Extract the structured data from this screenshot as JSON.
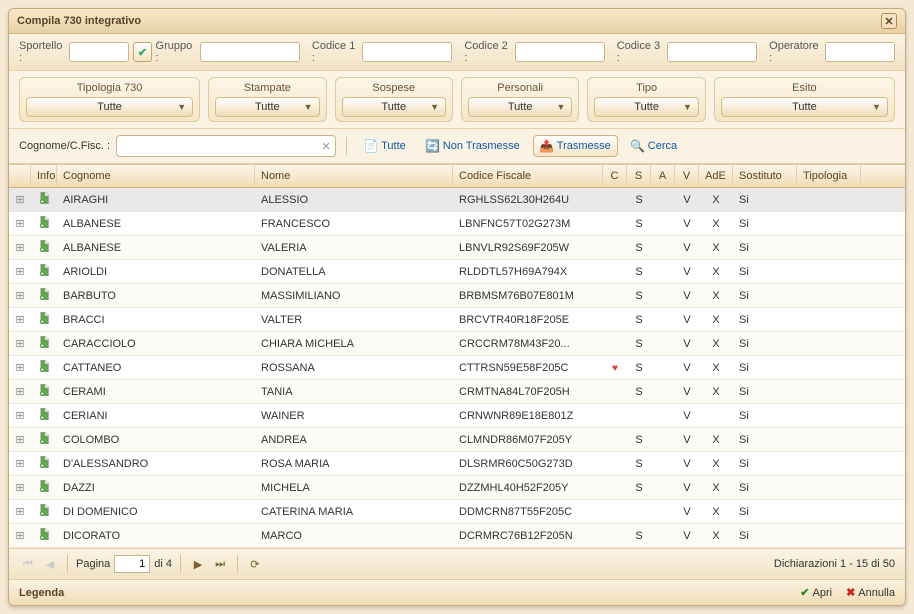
{
  "window": {
    "title": "Compila 730 integrativo"
  },
  "filters1": {
    "sportello": "Sportello :",
    "gruppo": "Gruppo :",
    "codice1": "Codice 1 :",
    "codice2": "Codice 2 :",
    "codice3": "Codice 3 :",
    "operatore": "Operatore :"
  },
  "dropdowns": [
    {
      "label": "Tipologia 730",
      "value": "Tutte"
    },
    {
      "label": "Stampate",
      "value": "Tutte"
    },
    {
      "label": "Sospese",
      "value": "Tutte"
    },
    {
      "label": "Personali",
      "value": "Tutte"
    },
    {
      "label": "Tipo",
      "value": "Tutte"
    },
    {
      "label": "Esito",
      "value": "Tutte"
    }
  ],
  "search": {
    "label": "Cognome/C.Fisc. :",
    "tutte": "Tutte",
    "non_trasmesse": "Non Trasmesse",
    "trasmesse": "Trasmesse",
    "cerca": "Cerca"
  },
  "columns": {
    "info": "Info",
    "cognome": "Cognome",
    "nome": "Nome",
    "cf": "Codice Fiscale",
    "c": "C",
    "s": "S",
    "a": "A",
    "v": "V",
    "ade": "AdE",
    "sostituto": "Sostituto",
    "tipologia": "Tipologia"
  },
  "rows": [
    {
      "cognome": "AIRAGHI",
      "nome": "ALESSIO",
      "cf": "RGHLSS62L30H264U",
      "c": "",
      "s": "S",
      "a": "",
      "v": "V",
      "ade": "X",
      "sost": "Si",
      "sel": true
    },
    {
      "cognome": "ALBANESE",
      "nome": "FRANCESCO",
      "cf": "LBNFNC57T02G273M",
      "c": "",
      "s": "S",
      "a": "",
      "v": "V",
      "ade": "X",
      "sost": "Si"
    },
    {
      "cognome": "ALBANESE",
      "nome": "VALERIA",
      "cf": "LBNVLR92S69F205W",
      "c": "",
      "s": "S",
      "a": "",
      "v": "V",
      "ade": "X",
      "sost": "Si"
    },
    {
      "cognome": "ARIOLDI",
      "nome": "DONATELLA",
      "cf": "RLDDTL57H69A794X",
      "c": "",
      "s": "S",
      "a": "",
      "v": "V",
      "ade": "X",
      "sost": "Si"
    },
    {
      "cognome": "BARBUTO",
      "nome": "MASSIMILIANO",
      "cf": "BRBMSM76B07E801M",
      "c": "",
      "s": "S",
      "a": "",
      "v": "V",
      "ade": "X",
      "sost": "Si"
    },
    {
      "cognome": "BRACCI",
      "nome": "VALTER",
      "cf": "BRCVTR40R18F205E",
      "c": "",
      "s": "S",
      "a": "",
      "v": "V",
      "ade": "X",
      "sost": "Si"
    },
    {
      "cognome": "CARACCIOLO",
      "nome": "CHIARA MICHELA",
      "cf": "CRCCRM78M43F20...",
      "c": "",
      "s": "S",
      "a": "",
      "v": "V",
      "ade": "X",
      "sost": "Si"
    },
    {
      "cognome": "CATTANEO",
      "nome": "ROSSANA",
      "cf": "CTTRSN59E58F205C",
      "c": "♥",
      "s": "S",
      "a": "",
      "v": "V",
      "ade": "X",
      "sost": "Si"
    },
    {
      "cognome": "CERAMI",
      "nome": "TANIA",
      "cf": "CRMTNA84L70F205H",
      "c": "",
      "s": "S",
      "a": "",
      "v": "V",
      "ade": "X",
      "sost": "Si"
    },
    {
      "cognome": "CERIANI",
      "nome": "WAINER",
      "cf": "CRNWNR89E18E801Z",
      "c": "",
      "s": "",
      "a": "",
      "v": "V",
      "ade": "",
      "sost": "Si"
    },
    {
      "cognome": "COLOMBO",
      "nome": "ANDREA",
      "cf": "CLMNDR86M07F205Y",
      "c": "",
      "s": "S",
      "a": "",
      "v": "V",
      "ade": "X",
      "sost": "Si"
    },
    {
      "cognome": "D'ALESSANDRO",
      "nome": "ROSA MARIA",
      "cf": "DLSRMR60C50G273D",
      "c": "",
      "s": "S",
      "a": "",
      "v": "V",
      "ade": "X",
      "sost": "Si"
    },
    {
      "cognome": "DAZZI",
      "nome": "MICHELA",
      "cf": "DZZMHL40H52F205Y",
      "c": "",
      "s": "S",
      "a": "",
      "v": "V",
      "ade": "X",
      "sost": "Si"
    },
    {
      "cognome": "DI DOMENICO",
      "nome": "CATERINA MARIA",
      "cf": "DDMCRN87T55F205C",
      "c": "",
      "s": "",
      "a": "",
      "v": "V",
      "ade": "X",
      "sost": "Si"
    },
    {
      "cognome": "DICORATO",
      "nome": "MARCO",
      "cf": "DCRMRC76B12F205N",
      "c": "",
      "s": "S",
      "a": "",
      "v": "V",
      "ade": "X",
      "sost": "Si"
    }
  ],
  "pager": {
    "pagina": "Pagina",
    "current": "1",
    "of": "di 4",
    "status": "Dichiarazioni 1 - 15 di 50"
  },
  "footer": {
    "legenda": "Legenda",
    "apri": "Apri",
    "annulla": "Annulla"
  }
}
